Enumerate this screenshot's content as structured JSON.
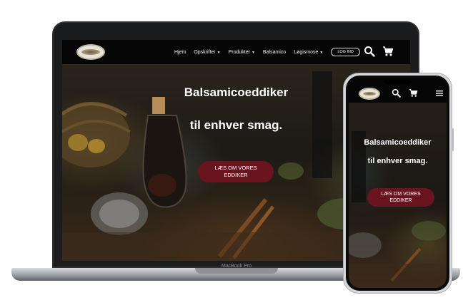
{
  "site": {
    "nav": {
      "items": [
        {
          "label": "Hjem",
          "dropdown": false
        },
        {
          "label": "Opskrifter",
          "dropdown": true
        },
        {
          "label": "Produkter",
          "dropdown": true
        },
        {
          "label": "Balsamico",
          "dropdown": false
        },
        {
          "label": "Løgismose",
          "dropdown": true
        }
      ],
      "login_label": "LOG IND",
      "icons": [
        "search-icon",
        "cart-icon",
        "menu-icon"
      ]
    },
    "hero": {
      "title_line1": "Balsamicoeddiker",
      "title_line2": "til enhver smag.",
      "button_line1": "LÆS OM VORES",
      "button_line2": "EDDIKER"
    },
    "logo_icon": "logismose-logo"
  },
  "device": {
    "laptop_label": "MacBook Pro"
  },
  "colors": {
    "nav_bg": "#060606",
    "button_bg": "#6a1420",
    "text": "#ffffff"
  }
}
